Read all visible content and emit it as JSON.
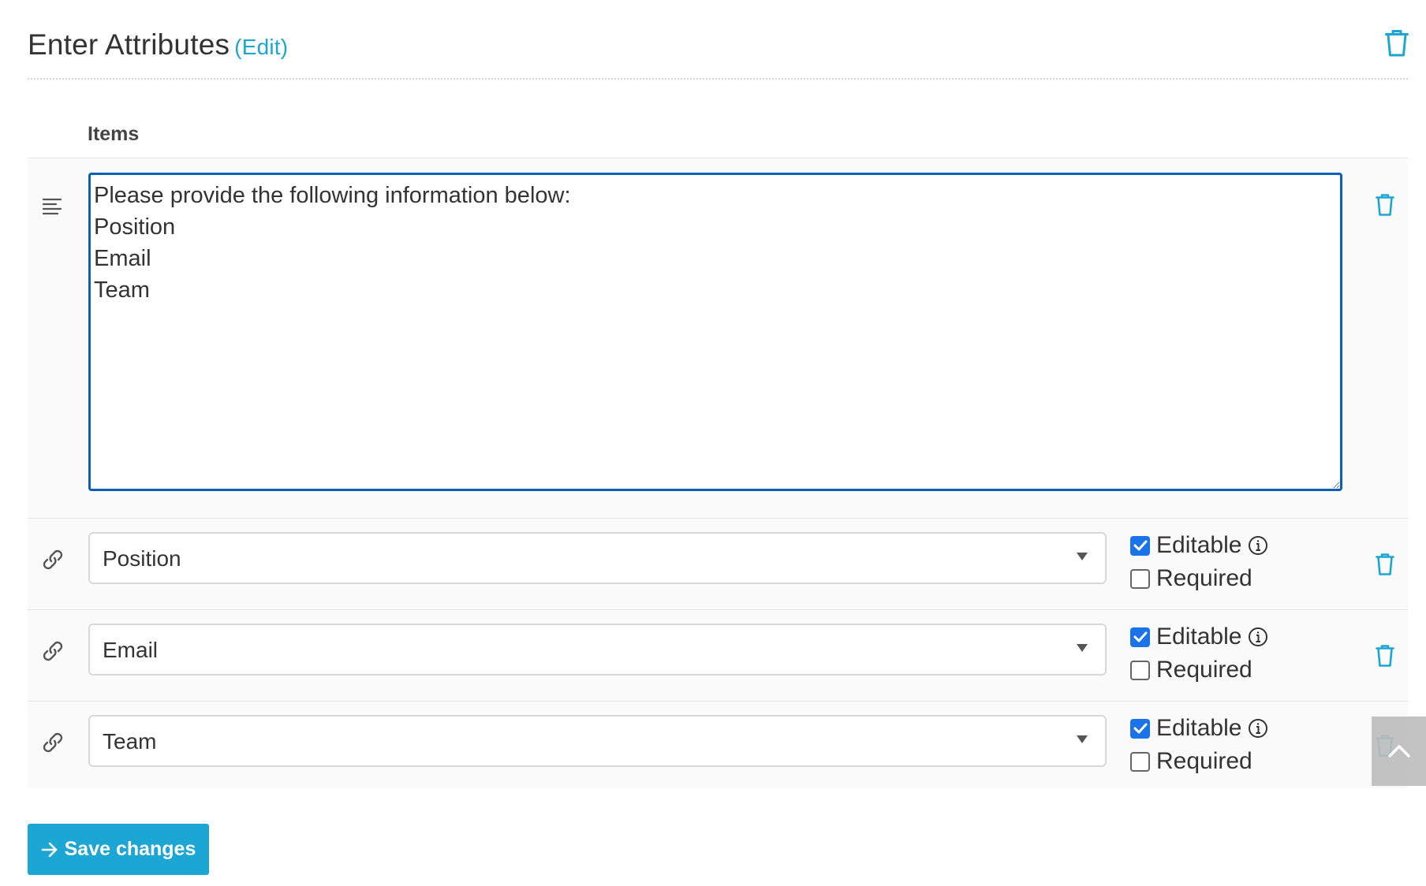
{
  "header": {
    "title": "Enter Attributes",
    "edit_label": "(Edit)"
  },
  "items": {
    "label": "Items"
  },
  "text_item": {
    "value": "Please provide the following information below:\nPosition\nEmail\nTeam"
  },
  "rows": [
    {
      "value": "Position",
      "editable_label": "Editable",
      "required_label": "Required",
      "editable": true,
      "required": false
    },
    {
      "value": "Email",
      "editable_label": "Editable",
      "required_label": "Required",
      "editable": true,
      "required": false
    },
    {
      "value": "Team",
      "editable_label": "Editable",
      "required_label": "Required",
      "editable": true,
      "required": false
    }
  ],
  "footer": {
    "save_label": "Save changes"
  },
  "colors": {
    "accent": "#1ba6d4",
    "focus_border": "#0b5fb5",
    "checkbox": "#1a73e8"
  },
  "icons": [
    "trash-icon",
    "text-lines-icon",
    "link-icon",
    "info-icon",
    "chevron-up-icon",
    "arrow-right-icon"
  ]
}
